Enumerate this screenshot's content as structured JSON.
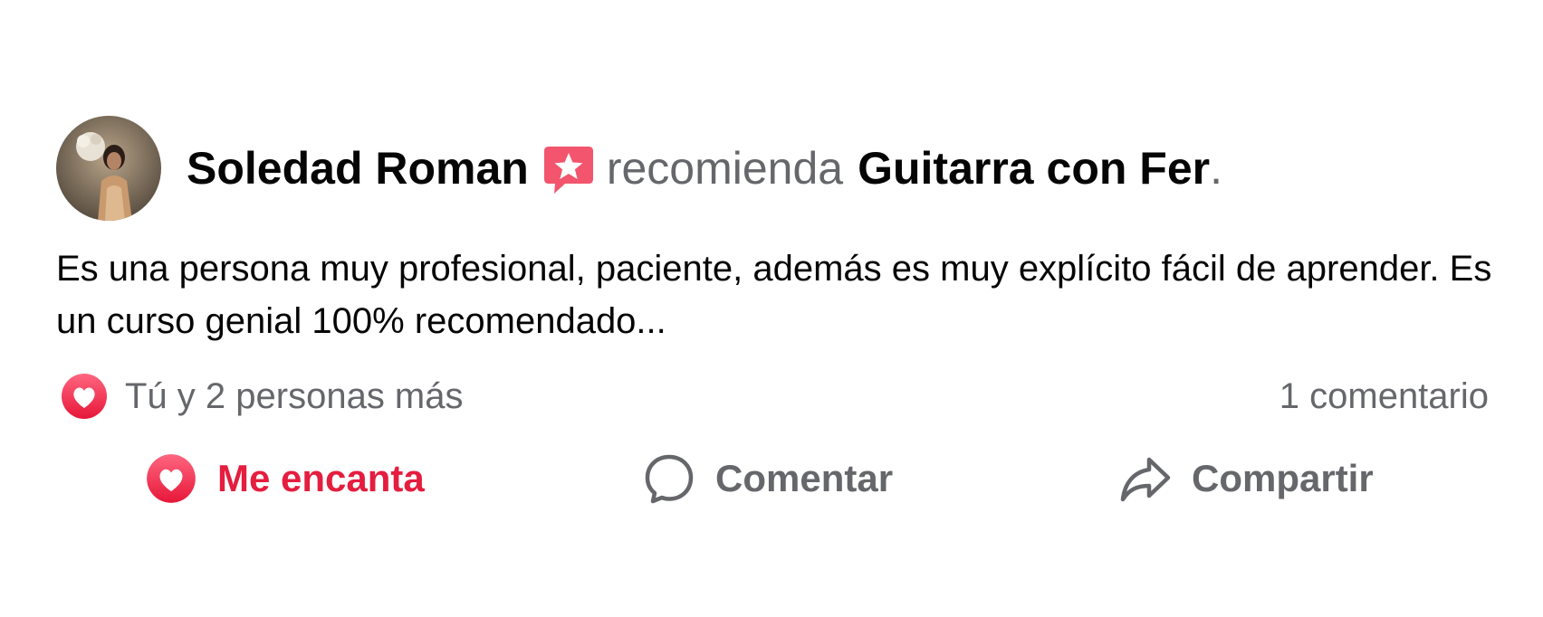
{
  "post": {
    "author": "Soledad Roman",
    "verb": "recomienda",
    "page": "Guitarra con Fer",
    "period": ".",
    "body": "Es una persona muy profesional, paciente, además es muy explícito fácil de aprender. Es un curso genial 100% recomendado...",
    "reactions_text": "Tú y 2 personas más",
    "comments_text": "1 comentario"
  },
  "actions": {
    "love_label": "Me encanta",
    "comment_label": "Comentar",
    "share_label": "Compartir"
  },
  "icons": {
    "recommend": "recommend-star-bubble-icon",
    "reaction": "love-reaction-icon",
    "love": "heart-icon",
    "comment": "comment-bubble-icon",
    "share": "share-arrow-icon"
  },
  "colors": {
    "love": "#e41e3f",
    "secondary_text": "#65676b",
    "primary_text": "#050505"
  }
}
